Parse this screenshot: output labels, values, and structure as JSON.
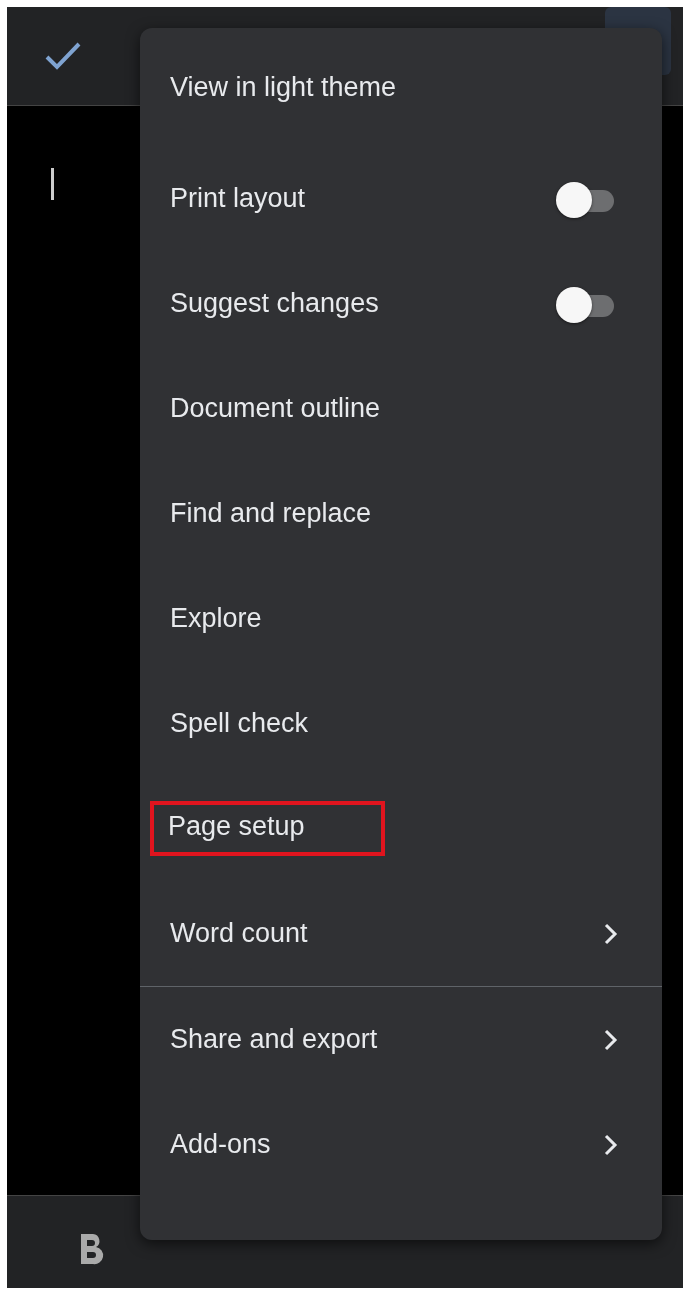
{
  "menu": {
    "items": [
      {
        "label": "View in light theme",
        "kind": "plain",
        "highlighted": false
      },
      {
        "label": "Print layout",
        "kind": "toggle",
        "on": false,
        "highlighted": false
      },
      {
        "label": "Suggest changes",
        "kind": "toggle",
        "on": false,
        "highlighted": false
      },
      {
        "label": "Document outline",
        "kind": "plain",
        "highlighted": false
      },
      {
        "label": "Find and replace",
        "kind": "plain",
        "highlighted": false
      },
      {
        "label": "Explore",
        "kind": "plain",
        "highlighted": false
      },
      {
        "label": "Spell check",
        "kind": "plain",
        "highlighted": false
      },
      {
        "label": "Page setup",
        "kind": "plain",
        "highlighted": true
      },
      {
        "label": "Word count",
        "kind": "submenu",
        "highlighted": false
      },
      {
        "kind": "divider"
      },
      {
        "label": "Share and export",
        "kind": "submenu",
        "highlighted": false
      },
      {
        "label": "Add-ons",
        "kind": "submenu",
        "highlighted": false
      }
    ]
  }
}
